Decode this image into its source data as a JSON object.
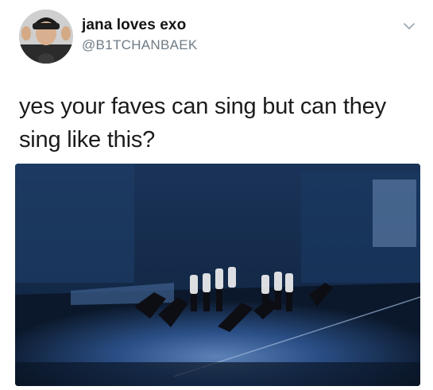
{
  "tweet": {
    "display_name": "jana loves exo",
    "handle": "@B1TCHANBAEK",
    "text_line_1": "yes your faves can sing but can they",
    "text_line_2": "sing like this?"
  },
  "icons": {
    "menu": "chevron-down-icon"
  },
  "colors": {
    "handle_gray": "#6f7b85",
    "stage_blue": "#1f4a86"
  }
}
